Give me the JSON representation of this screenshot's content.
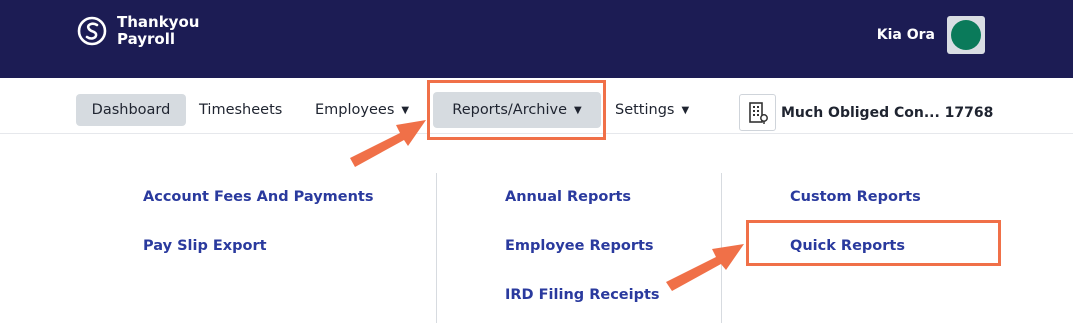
{
  "header": {
    "logo_line1": "Thankyou",
    "logo_line2": "Payroll",
    "user_name": "Kia Ora"
  },
  "nav": {
    "dashboard": "Dashboard",
    "timesheets": "Timesheets",
    "employees": "Employees",
    "reports": "Reports/Archive",
    "settings": "Settings",
    "company": "Much Obliged Con... 17768"
  },
  "menu": {
    "col1": [
      "Account Fees And Payments",
      "Pay Slip Export"
    ],
    "col2": [
      "Annual Reports",
      "Employee Reports",
      "IRD Filing Receipts"
    ],
    "col3": [
      "Custom Reports",
      "Quick Reports"
    ]
  },
  "colors": {
    "header_bg": "#1c1c54",
    "link": "#2a3a9e",
    "highlight": "#f07048"
  }
}
